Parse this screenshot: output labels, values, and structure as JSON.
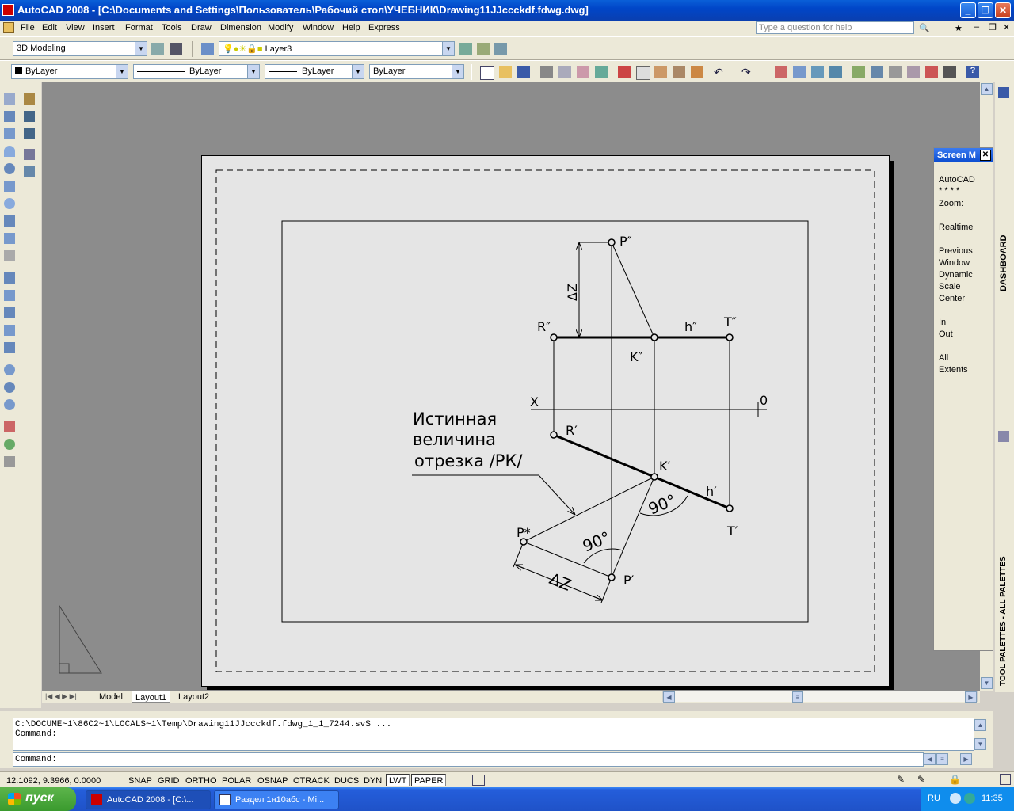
{
  "window": {
    "title": "AutoCAD 2008 - [C:\\Documents and Settings\\Пользователь\\Рабочий стол\\УЧЕБНИК\\Drawing11JJccckdf.fdwg.dwg]"
  },
  "menu": {
    "items": [
      "File",
      "Edit",
      "View",
      "Insert",
      "Format",
      "Tools",
      "Draw",
      "Dimension",
      "Modify",
      "Window",
      "Help",
      "Express"
    ],
    "help_placeholder": "Type a question for help"
  },
  "toolbar": {
    "workspace": "3D Modeling",
    "layer": "Layer3",
    "color": "ByLayer",
    "linetype": "ByLayer",
    "lineweight": "ByLayer",
    "plotstyle": "ByLayer"
  },
  "drawing": {
    "labels": {
      "p2": "P″",
      "r2": "R″",
      "h2": "h″",
      "t2": "T″",
      "k2": "K″",
      "x": "X",
      "o": "0",
      "r1": "R′",
      "k1": "K′",
      "h1": "h′",
      "t1": "T′",
      "pstar": "P*",
      "p1": "P′",
      "dz_top": "ΔZ",
      "dz_bottom": "ΔZ",
      "angle1": "90°",
      "angle2": "90°",
      "note_line1": "Истинная",
      "note_line2": "величина",
      "note_line3": "отрезка /РК/"
    }
  },
  "tabs": [
    "Model",
    "Layout1",
    "Layout2"
  ],
  "screen_menu": {
    "title": "Screen M",
    "items": [
      "AutoCAD",
      "* * * *",
      "Zoom:",
      "",
      "Realtime",
      "",
      "Previous",
      "Window",
      "Dynamic",
      "Scale",
      "Center",
      "",
      "In",
      "Out",
      "",
      "All",
      "Extents"
    ]
  },
  "side_labels": {
    "dashboard": "DASHBOARD",
    "palettes": "TOOL PALETTES - ALL PALETTES"
  },
  "command": {
    "line1": "C:\\DOCUME~1\\86C2~1\\LOCALS~1\\Temp\\Drawing11JJccckdf.fdwg_1_1_7244.sv$ ...",
    "line2": "Command:",
    "prompt": "Command:"
  },
  "status": {
    "coords": "12.1092, 9.3966, 0.0000",
    "toggles": [
      "SNAP",
      "GRID",
      "ORTHO",
      "POLAR",
      "OSNAP",
      "OTRACK",
      "DUCS",
      "DYN",
      "LWT",
      "PAPER"
    ]
  },
  "taskbar": {
    "start": "пуск",
    "tasks": [
      "AutoCAD 2008 - [C:\\...",
      "Раздел 1н10абс - Mi..."
    ],
    "lang": "RU",
    "time": "11:35"
  },
  "colors": {
    "titlebar": "#0a5fd8",
    "drawbg": "#8c8c8c",
    "paper": "#e5e5e5"
  }
}
